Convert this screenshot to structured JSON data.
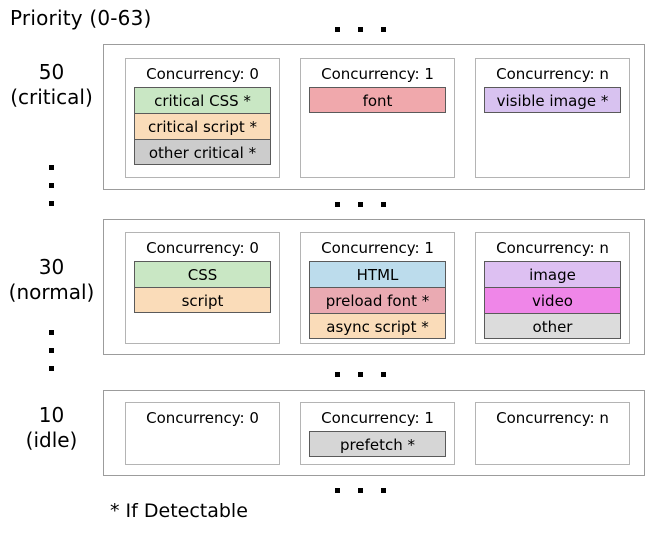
{
  "header": {
    "title": "Priority (0-63)"
  },
  "footnote": "* If Detectable",
  "ellipsis_symbol": ". . .",
  "colors": {
    "green": "#c9e7c4",
    "peach": "#fadcb9",
    "gray": "#cccccc",
    "red": "#f0a8ac",
    "lavender": "#d8c2f0",
    "blue": "#bcdcec",
    "pink": "#eaaab2",
    "violet": "#ddc0f2",
    "magenta": "#ef86e8",
    "light_gray": "#dcdcdc",
    "prefetch_gray": "#d6d6d6",
    "band_border": "#9c9c9c",
    "column_border": "#b4b4b4",
    "chip_border": "#5a5a5a"
  },
  "bands": [
    {
      "priority": "50",
      "priority_name": "(critical)",
      "columns": [
        {
          "title": "Concurrency: 0",
          "items": [
            {
              "label": "critical CSS *",
              "color": "#c9e7c4"
            },
            {
              "label": "critical script *",
              "color": "#fadcb9"
            },
            {
              "label": "other critical *",
              "color": "#cccccc"
            }
          ]
        },
        {
          "title": "Concurrency: 1",
          "items": [
            {
              "label": "font",
              "color": "#f0a8ac"
            }
          ]
        },
        {
          "title": "Concurrency: n",
          "items": [
            {
              "label": "visible image *",
              "color": "#d8c2f0"
            }
          ]
        }
      ]
    },
    {
      "priority": "30",
      "priority_name": "(normal)",
      "columns": [
        {
          "title": "Concurrency: 0",
          "items": [
            {
              "label": "CSS",
              "color": "#c9e7c4"
            },
            {
              "label": "script",
              "color": "#fadcb9"
            }
          ]
        },
        {
          "title": "Concurrency: 1",
          "items": [
            {
              "label": "HTML",
              "color": "#bcdcec"
            },
            {
              "label": "preload font *",
              "color": "#eaaab2"
            },
            {
              "label": "async script *",
              "color": "#fadcb9"
            }
          ]
        },
        {
          "title": "Concurrency: n",
          "items": [
            {
              "label": "image",
              "color": "#ddc0f2"
            },
            {
              "label": "video",
              "color": "#ef86e8"
            },
            {
              "label": "other",
              "color": "#dcdcdc"
            }
          ]
        }
      ]
    },
    {
      "priority": "10",
      "priority_name": "(idle)",
      "columns": [
        {
          "title": "Concurrency: 0",
          "items": []
        },
        {
          "title": "Concurrency: 1",
          "items": [
            {
              "label": "prefetch *",
              "color": "#d6d6d6"
            }
          ]
        },
        {
          "title": "Concurrency: n",
          "items": []
        }
      ]
    }
  ]
}
